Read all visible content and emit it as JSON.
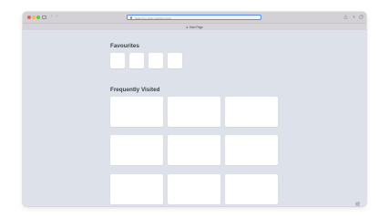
{
  "toolbar": {
    "back_icon": "chevron-left-icon",
    "forward_icon": "chevron-right-icon",
    "address_placeholder": "Search or enter website name",
    "share_icon": "share-icon",
    "new_tab_icon": "plus-icon",
    "tab_overview_icon": "tab-overview-icon"
  },
  "tab": {
    "title": "Start Page",
    "icon": "star-icon"
  },
  "favourites": {
    "title": "Favourites",
    "tiles": [
      "",
      "",
      "",
      ""
    ]
  },
  "frequently_visited": {
    "title": "Frequently Visited",
    "tiles": [
      "",
      "",
      "",
      "",
      "",
      "",
      "",
      "",
      ""
    ]
  },
  "customize_icon": "sliders-icon",
  "colors": {
    "page_background": "#dde2ea",
    "toolbar_background": "#d3d1d6",
    "address_focus": "#5b8ee8",
    "tile": "#ffffff"
  }
}
